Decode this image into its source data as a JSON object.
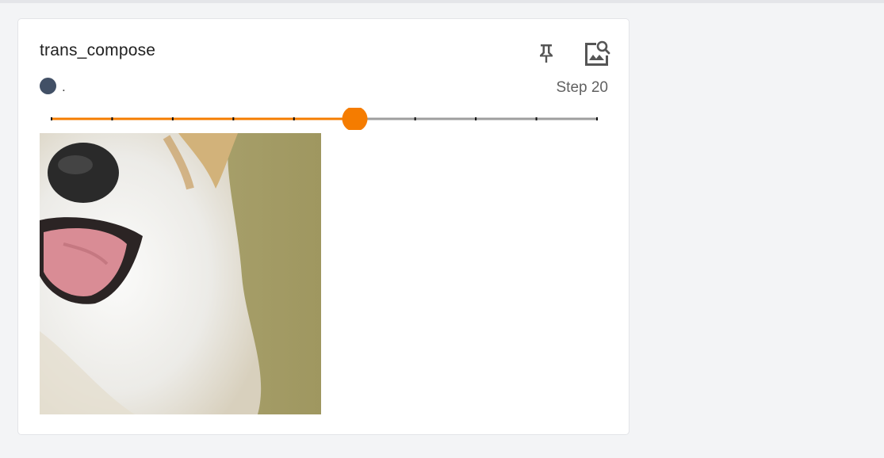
{
  "card": {
    "title": "trans_compose",
    "run_name": ".",
    "run_color": "#425066",
    "step_label": "Step 20",
    "pin_icon": "pin-icon",
    "zoom_icon": "image-search-icon"
  },
  "slider": {
    "progress_fraction": 0.556,
    "tick_count": 10,
    "active_color": "#f57c00",
    "inactive_color": "#9e9e9e"
  },
  "image": {
    "subject": "dog-photo",
    "background_color": "#a19a5c"
  }
}
